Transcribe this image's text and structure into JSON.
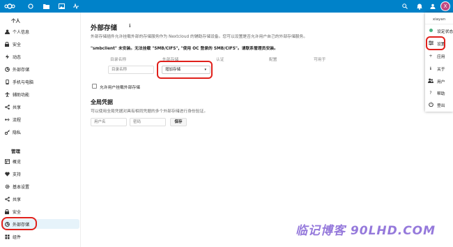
{
  "topbar": {
    "avatar_letter": "X"
  },
  "sidebar": {
    "personal_caption": "个人",
    "admin_caption": "管理",
    "personal_items": [
      {
        "label": "个人信息",
        "icon": "person-icon"
      },
      {
        "label": "安全",
        "icon": "lock-icon"
      },
      {
        "label": "动态",
        "icon": "activity-icon"
      },
      {
        "label": "外部存储",
        "icon": "external-storage-icon"
      },
      {
        "label": "手机与电脑",
        "icon": "phone-icon"
      },
      {
        "label": "辅助功能",
        "icon": "accessibility-icon"
      },
      {
        "label": "共享",
        "icon": "share-icon"
      },
      {
        "label": "流程",
        "icon": "flow-icon"
      },
      {
        "label": "隐私",
        "icon": "privacy-key-icon"
      }
    ],
    "admin_items": [
      {
        "label": "概览",
        "icon": "overview-icon"
      },
      {
        "label": "支持",
        "icon": "support-icon"
      },
      {
        "label": "基本设置",
        "icon": "gear-icon"
      },
      {
        "label": "共享",
        "icon": "share-icon"
      },
      {
        "label": "安全",
        "icon": "lock-icon"
      },
      {
        "label": "外部存储",
        "icon": "external-storage-icon"
      },
      {
        "label": "组件",
        "icon": "apps-icon"
      }
    ]
  },
  "main": {
    "title": "外部存储",
    "description": "外部存储插件允许挂载外部的存储服务作为 Nextcloud 的辅助存储设备。您可以设置是否允许用户自己的外部存储服务。",
    "warning": "\"smbclient\" 未安装。无法挂载 \"SMB/CIFS\", \"使用 OC 登录的 SMB/CIFS\"。请联系管理员安装。",
    "columns": [
      "目录名称",
      "外部存储",
      "认证",
      "配置",
      "可用于"
    ],
    "folder_placeholder": "目录名称",
    "add_storage_label": "增加存储",
    "allow_user_mount_label": "允许用户挂载外部存储",
    "global_creds_title": "全局凭据",
    "global_creds_desc": "可以使用全局凭据对具有相同凭据的多个外部存储进行身份验证。",
    "username_placeholder": "用户名",
    "password_placeholder": "密码",
    "save_label": "保存"
  },
  "menu": {
    "username": "xiayan",
    "items": [
      {
        "label": "设定状态",
        "icon": "status-dot-icon"
      },
      {
        "label": "设置",
        "icon": "settings-sliders-icon"
      },
      {
        "label": "应用",
        "icon": "plus-icon"
      },
      {
        "label": "关于",
        "icon": "info-icon"
      },
      {
        "label": "用户",
        "icon": "users-icon"
      },
      {
        "label": "帮助",
        "icon": "help-icon"
      },
      {
        "label": "登出",
        "icon": "power-icon"
      }
    ]
  },
  "watermark": "临记博客 90LHD.COM",
  "colors": {
    "brand": "#0082c9",
    "highlight": "#e0201b",
    "active_bg": "#e6f3fa",
    "avatar": "#c24a82"
  }
}
